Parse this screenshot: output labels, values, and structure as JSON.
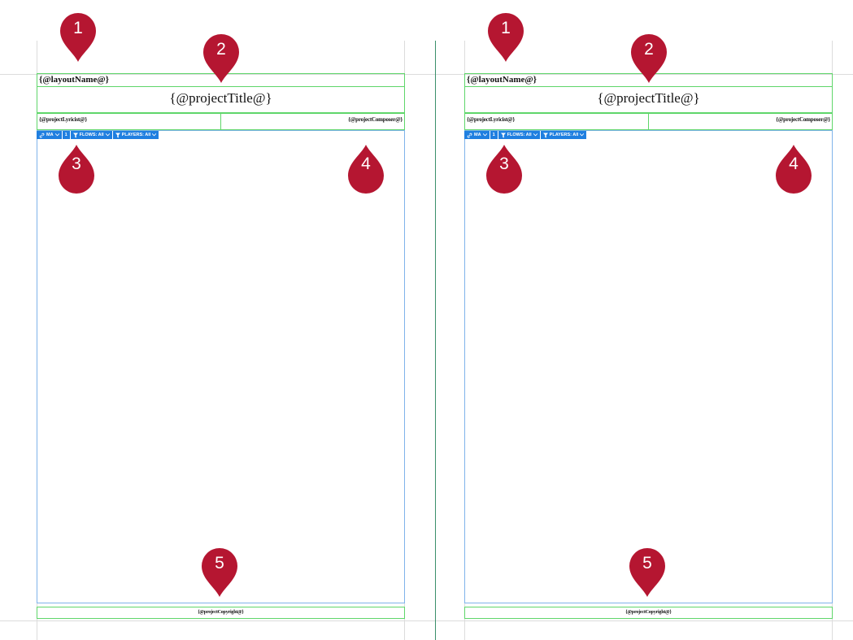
{
  "colors": {
    "frame_green": "#5fd66a",
    "frame_blue": "#7fb3ea",
    "marker": "#b51631",
    "toolbar": "#1f7fe0"
  },
  "template": {
    "layout_name": "{@layoutName@}",
    "project_title": "{@projectTitle@}",
    "lyricist": "{@projectLyricist@}",
    "composer": "{@projectComposer@}",
    "copyright": "{@projectCopyright@}"
  },
  "toolbar": {
    "link_label": "MA",
    "count_label": "1",
    "flows_label": "FLOWS: All",
    "players_label": "PLAYERS: All",
    "icons": [
      "link-icon",
      "filter-icon",
      "chevron-down-icon"
    ]
  },
  "markers": [
    "1",
    "2",
    "3",
    "4",
    "5"
  ]
}
